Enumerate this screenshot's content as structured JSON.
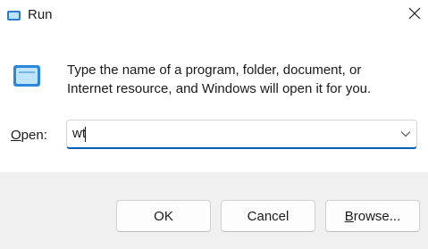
{
  "window": {
    "title": "Run",
    "close_icon": "close-icon",
    "title_icon": "run-app-icon"
  },
  "main": {
    "description": "Type the name of a program, folder, document, or Internet resource, and Windows will open it for you.",
    "icon": "run-dialog-icon"
  },
  "open_field": {
    "label_accel": "O",
    "label_rest": "pen:",
    "value": "wt",
    "dropdown_icon": "chevron-down-icon"
  },
  "buttons": {
    "ok": "OK",
    "cancel": "Cancel",
    "browse_accel": "B",
    "browse_rest": "rowse..."
  },
  "colors": {
    "accent": "#005fb8",
    "content_bg": "#ffffff",
    "footer_bg": "#f0f0f0",
    "icon_blue": "#4aa3df"
  }
}
